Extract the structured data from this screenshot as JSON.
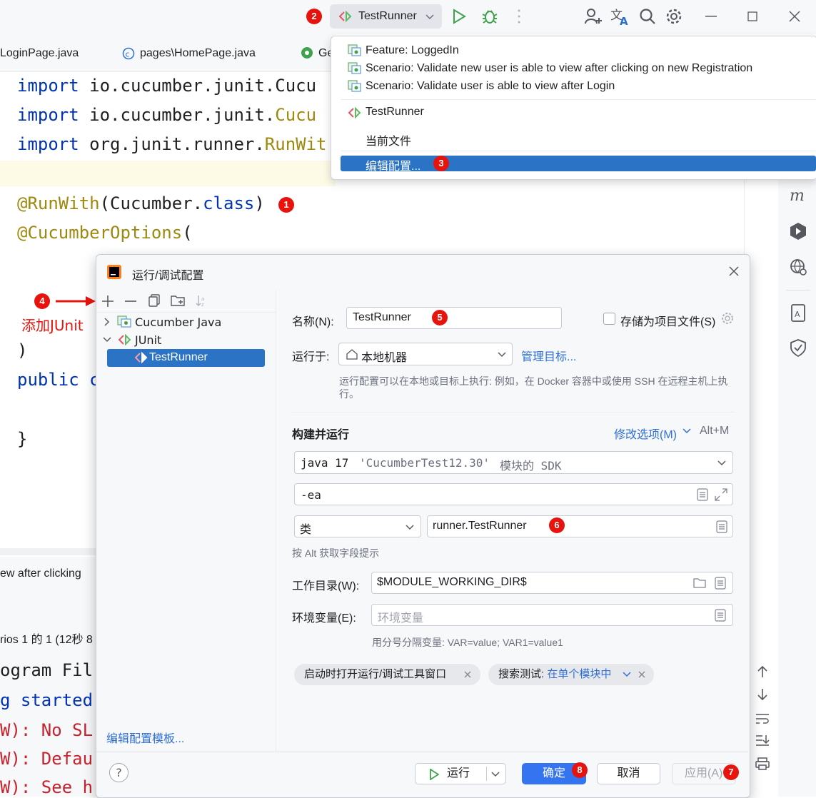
{
  "titlebar": {
    "run_config_name": "TestRunner",
    "badge": "2"
  },
  "tabs": [
    {
      "label": "LoginPage.java"
    },
    {
      "label": "pages\\HomePage.java"
    },
    {
      "label": "Ge"
    }
  ],
  "editor": {
    "lines": [
      {
        "kw": "import",
        "rest": " io.cucumber.junit.Cucu"
      },
      {
        "kw": "import",
        "rest": " io.cucumber.junit.",
        "cls": "Cucu"
      },
      {
        "kw": "import",
        "rest": " org.junit.runner.",
        "cls": "RunWit"
      }
    ],
    "runwith": {
      "ann": "@RunWith",
      "open": "(Cucumber.",
      "cls": "class",
      "close": ")"
    },
    "options": {
      "ann": "@CucumberOptions",
      "rest": "("
    },
    "paren_close": ")",
    "public_line": {
      "kw": "public",
      "rest": " c"
    },
    "brace_close": "}",
    "badge_runwith": "1",
    "annot_badge": "4",
    "annot_text": "添加JUnit"
  },
  "popup": {
    "items": [
      {
        "label": "Feature: LoggedIn"
      },
      {
        "label": "Scenario: Validate new user is able to view after clicking on new Registration"
      },
      {
        "label": "Scenario: Validate user is able to view after Login"
      }
    ],
    "config_item": "TestRunner",
    "current_file": "当前文件",
    "edit_configs": "编辑配置...",
    "badge": "3"
  },
  "bottom": {
    "status_line": "ew after clicking",
    "summary": "rios 1 的 1  (12秒 8",
    "console": [
      {
        "text": "ogram Fil",
        "color": "#1e1f22"
      },
      {
        "text": "g started",
        "color": "#0033b3"
      },
      {
        "text": "W): No SL",
        "color": "#c7222d"
      },
      {
        "text": "W): Defau",
        "color": "#c7222d"
      },
      {
        "text": "W): See h",
        "color": "#c7222d"
      }
    ]
  },
  "dialog": {
    "title": "运行/调试配置",
    "tree": {
      "cucumber": "Cucumber Java",
      "junit": "JUnit",
      "selected": "TestRunner"
    },
    "edit_templates": "编辑配置模板...",
    "name_label": "名称(N):",
    "name_value": "TestRunner",
    "name_badge": "5",
    "store_label": "存储为项目文件(S)",
    "run_on_label": "运行于:",
    "run_on_value": "本地机器",
    "manage_targets": "管理目标...",
    "run_on_hint": "运行配置可以在本地或目标上执行: 例如，在 Docker 容器中或使用 SSH 在远程主机上执行。",
    "build_run": "构建并运行",
    "modify_options": "修改选项(M)",
    "modify_shortcut": "Alt+M",
    "sdk_java": "java 17",
    "sdk_module": "'CucumberTest12.30'",
    "sdk_suffix": "模块的 SDK",
    "vm_options": "-ea",
    "kind_value": "类",
    "class_value": "runner.TestRunner",
    "class_badge": "6",
    "alt_hint": "按 Alt 获取字段提示",
    "workdir_label": "工作目录(W):",
    "workdir_value": "$MODULE_WORKING_DIR$",
    "env_label": "环境变量(E):",
    "env_placeholder": "环境变量",
    "env_hint": "用分号分隔变量: VAR=value; VAR1=value1",
    "chip1": "启动时打开运行/调试工具窗口",
    "chip2_label": "搜索测试: ",
    "chip2_value": "在单个模块中",
    "btn_run": "运行",
    "btn_ok": "确定",
    "btn_ok_badge": "8",
    "btn_cancel": "取消",
    "btn_apply": "应用(A)",
    "btn_apply_badge": "7",
    "help": "?"
  }
}
